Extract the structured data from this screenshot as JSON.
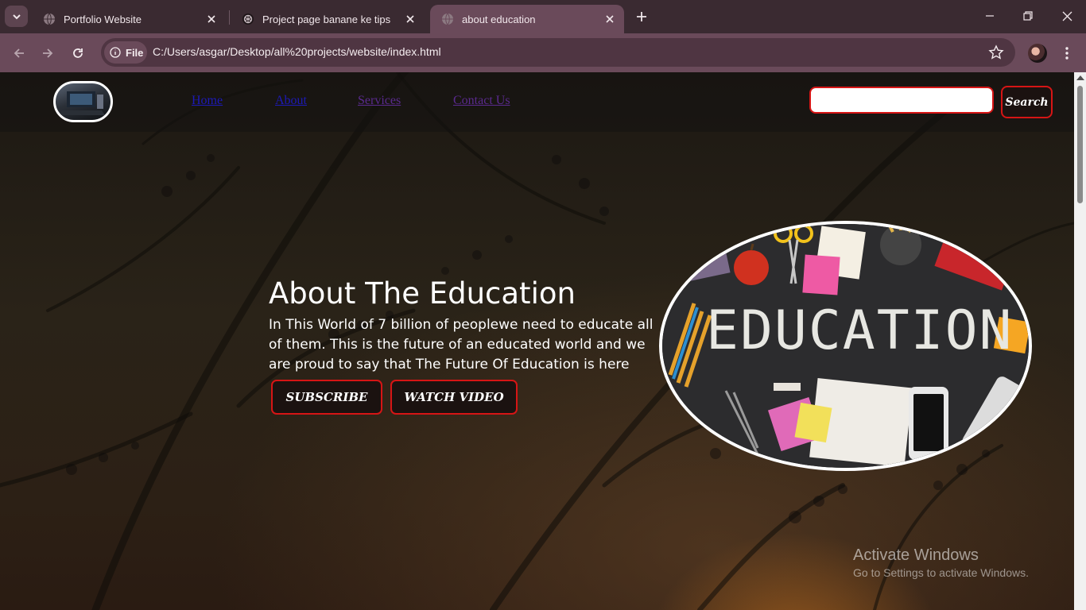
{
  "browser": {
    "tabs": [
      {
        "title": "Portfolio Website",
        "icon": "globe-icon",
        "active": false
      },
      {
        "title": "Project page banane ke tips",
        "icon": "openai-icon",
        "active": false
      },
      {
        "title": "about education",
        "icon": "globe-icon",
        "active": true
      }
    ],
    "address": {
      "chip_label": "File",
      "url": "C:/Users/asgar/Desktop/all%20projects/website/index.html"
    }
  },
  "site": {
    "nav": [
      "Home",
      "About",
      "Services",
      "Contact Us"
    ],
    "search": {
      "placeholder": "",
      "button_label": "Search"
    },
    "hero": {
      "title": "About The Education",
      "text": "In This World of 7 billion of peoplewe need to educate all of them. This is the future of an educated world and we are proud to say that The Future Of Education is here",
      "buttons": [
        "SUBSCRIBE",
        "WATCH VIDEO"
      ]
    },
    "image_caption": "EDUCATION"
  },
  "os_watermark": {
    "line1": "Activate Windows",
    "line2": "Go to Settings to activate Windows."
  },
  "colors": {
    "accent_red": "#d61515",
    "chrome_tabbar": "#3a2a31",
    "chrome_toolbar": "#6a4a5a"
  }
}
